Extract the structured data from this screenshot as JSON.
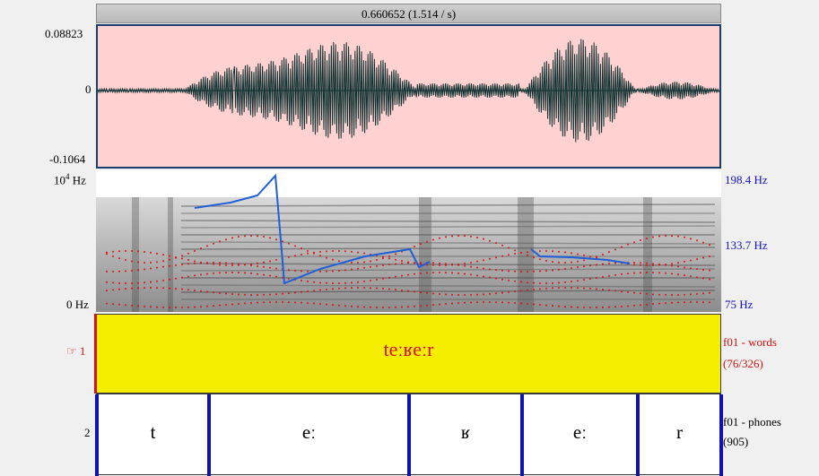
{
  "selection": {
    "text": "0.660652 (1.514 / s)"
  },
  "waveform": {
    "ymax": "0.08823",
    "yzero": "0",
    "ymin": "-0.1064",
    "background": "#ffd1d1",
    "wave_color": "#0f3131"
  },
  "spectrogram": {
    "freq_top": "10",
    "freq_top_exp": "4",
    "freq_top_unit": " Hz",
    "freq_bottom": "0 Hz",
    "pitch_top": "198.4 Hz",
    "pitch_mid": "133.7 Hz",
    "pitch_bottom": "75 Hz",
    "pitch_color": "#1f5fd8",
    "formant_color": "#e01010"
  },
  "tiers": [
    {
      "number": "1",
      "pointer_icon": "☞",
      "text": "teːʁeːr",
      "name": "f01 - words",
      "count": "(76/326)",
      "color": "#f6ee00"
    },
    {
      "number": "2",
      "name": "f01 - phones",
      "count": "(905)",
      "segments": [
        "t",
        "eː",
        "ʁ",
        "eː",
        "r"
      ]
    }
  ]
}
